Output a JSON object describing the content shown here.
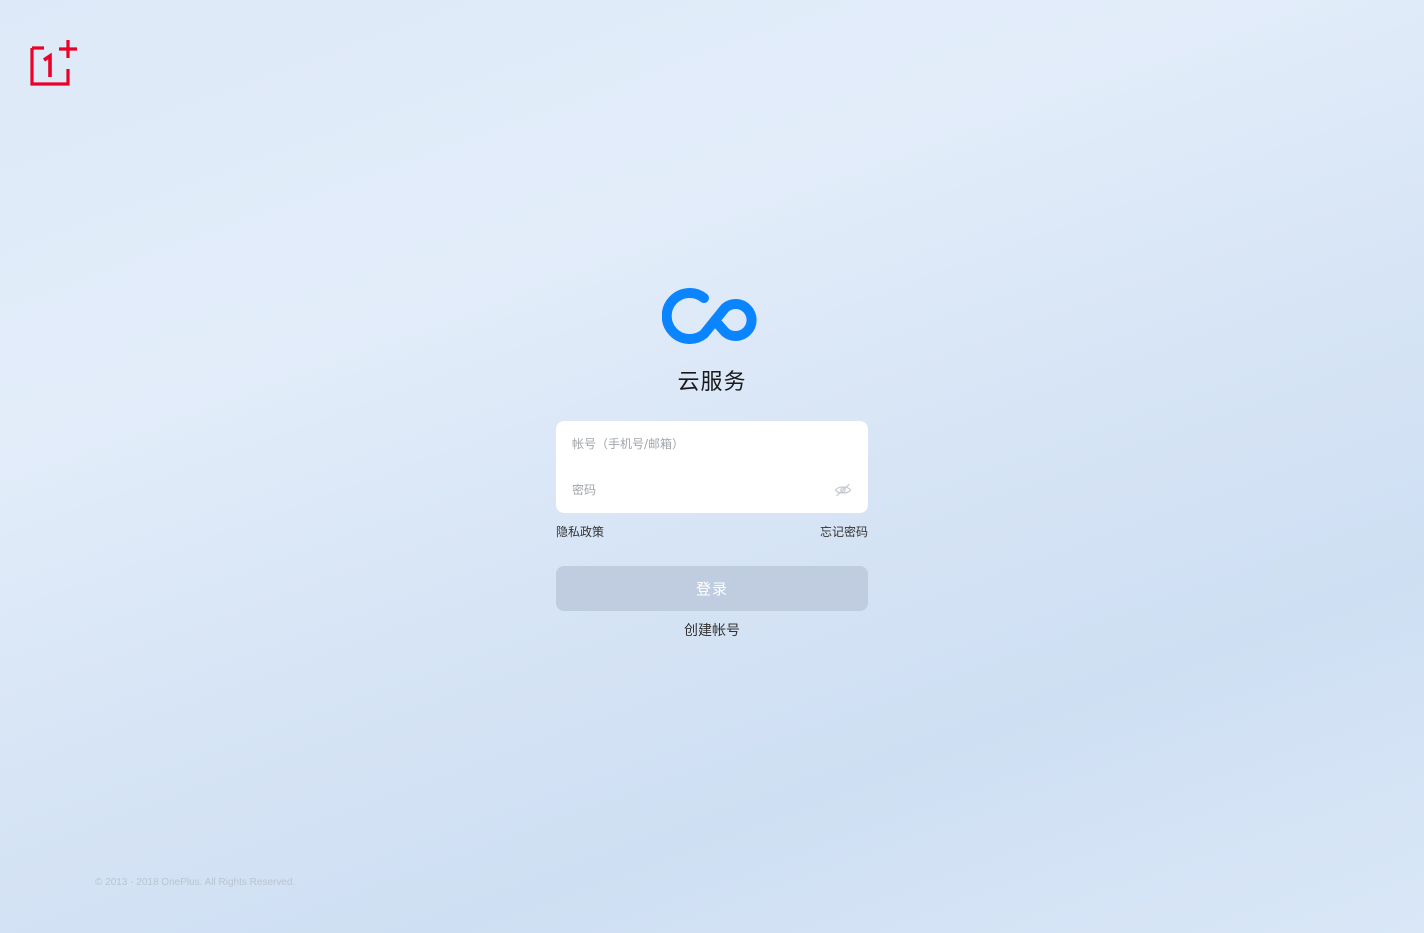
{
  "app": {
    "title": "云服务",
    "accent_color": "#0a84ff",
    "brand_color": "#eb0028"
  },
  "form": {
    "account_placeholder": "帐号（手机号/邮箱）",
    "password_placeholder": "密码",
    "privacy_label": "隐私政策",
    "forgot_label": "忘记密码",
    "login_label": "登录",
    "create_label": "创建帐号"
  },
  "footer": {
    "copyright": "© 2013 - 2018 OnePlus. All Rights Reserved."
  },
  "icons": {
    "brand": "oneplus-logo-icon",
    "app": "cloud-infinity-icon",
    "password_toggle": "eye-off-icon"
  }
}
